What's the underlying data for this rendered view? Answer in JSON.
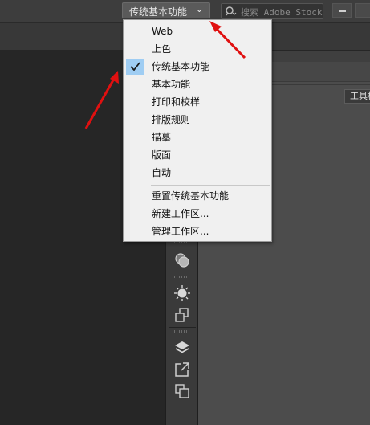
{
  "header": {
    "workspace_label": "传统基本功能",
    "search_placeholder": "搜索 Adobe Stock"
  },
  "panel": {
    "toolbar_label": "工具栏"
  },
  "workspace_menu": {
    "items": [
      {
        "label": "Web",
        "checked": false
      },
      {
        "label": "上色",
        "checked": false
      },
      {
        "label": "传统基本功能",
        "checked": true
      },
      {
        "label": "基本功能",
        "checked": false
      },
      {
        "label": "打印和校样",
        "checked": false
      },
      {
        "label": "排版规则",
        "checked": false
      },
      {
        "label": "描摹",
        "checked": false
      },
      {
        "label": "版面",
        "checked": false
      },
      {
        "label": "自动",
        "checked": false
      }
    ],
    "actions": [
      {
        "label": "重置传统基本功能"
      },
      {
        "label": "新建工作区..."
      },
      {
        "label": "管理工作区..."
      }
    ]
  },
  "dock_icons": [
    "appearance-icon",
    "sun-icon",
    "transform-icon",
    "layers-icon",
    "export-icon",
    "artboards-icon"
  ],
  "colors": {
    "annotation_arrow": "#e01010",
    "checked_highlight": "#9fcdf3"
  }
}
